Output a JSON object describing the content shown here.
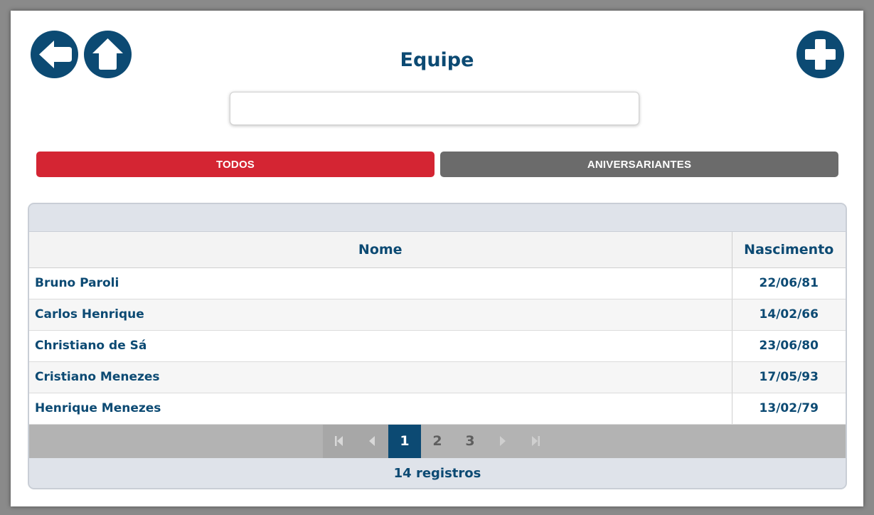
{
  "header": {
    "title": "Equipe",
    "back_icon": "arrow-left-icon",
    "home_icon": "arrow-up-icon",
    "add_icon": "plus-icon"
  },
  "search": {
    "value": "",
    "placeholder": ""
  },
  "filters": {
    "todos_label": "TODOS",
    "aniversariantes_label": "ANIVERSARIANTES"
  },
  "grid": {
    "columns": {
      "name": "Nome",
      "birth": "Nascimento"
    },
    "rows": [
      {
        "name": "Bruno Paroli",
        "birth": "22/06/81"
      },
      {
        "name": "Carlos Henrique",
        "birth": "14/02/66"
      },
      {
        "name": "Christiano de Sá",
        "birth": "23/06/80"
      },
      {
        "name": "Cristiano Menezes",
        "birth": "17/05/93"
      },
      {
        "name": "Henrique Menezes",
        "birth": "13/02/79"
      }
    ],
    "pager": {
      "pages": [
        "1",
        "2",
        "3"
      ],
      "current": "1"
    },
    "footer": "14 registros"
  },
  "colors": {
    "primary": "#0c4a73",
    "accent_red": "#d42533",
    "inactive_gray": "#6b6b6b"
  }
}
